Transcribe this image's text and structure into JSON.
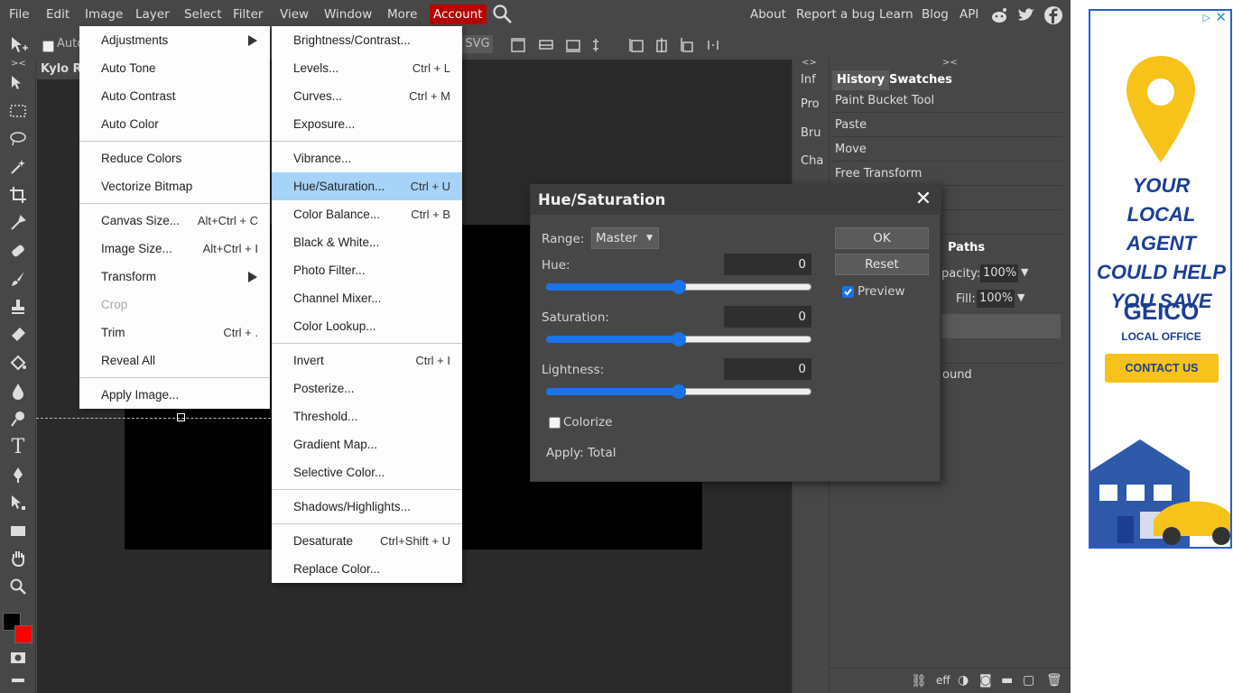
{
  "menubar": {
    "items": [
      "File",
      "Edit",
      "Image",
      "Layer",
      "Select",
      "Filter",
      "View",
      "Window",
      "More",
      "Account"
    ],
    "right_items": [
      "About",
      "Report a bug",
      "Learn",
      "Blog",
      "API"
    ]
  },
  "optbar": {
    "auto_select_label": "Auto",
    "svg_label": "SVG"
  },
  "document": {
    "tab_title": "Kylo Re"
  },
  "image_menu": {
    "items": [
      {
        "label": "Adjustments",
        "shortcut": "",
        "submenu": true
      },
      {
        "label": "Auto Tone",
        "shortcut": ""
      },
      {
        "label": "Auto Contrast",
        "shortcut": ""
      },
      {
        "label": "Auto Color",
        "shortcut": ""
      },
      {
        "sep": true
      },
      {
        "label": "Reduce Colors",
        "shortcut": ""
      },
      {
        "label": "Vectorize Bitmap",
        "shortcut": ""
      },
      {
        "sep": true
      },
      {
        "label": "Canvas Size...",
        "shortcut": "Alt+Ctrl + C"
      },
      {
        "label": "Image Size...",
        "shortcut": "Alt+Ctrl + I"
      },
      {
        "label": "Transform",
        "shortcut": "",
        "submenu": true
      },
      {
        "label": "Crop",
        "shortcut": "",
        "disabled": true
      },
      {
        "label": "Trim",
        "shortcut": "Ctrl + ."
      },
      {
        "label": "Reveal All",
        "shortcut": ""
      },
      {
        "sep": true
      },
      {
        "label": "Apply Image...",
        "shortcut": ""
      }
    ]
  },
  "adjust_menu": {
    "items": [
      {
        "label": "Brightness/Contrast...",
        "shortcut": ""
      },
      {
        "label": "Levels...",
        "shortcut": "Ctrl + L"
      },
      {
        "label": "Curves...",
        "shortcut": "Ctrl + M"
      },
      {
        "label": "Exposure...",
        "shortcut": ""
      },
      {
        "sep": true
      },
      {
        "label": "Vibrance...",
        "shortcut": ""
      },
      {
        "label": "Hue/Saturation...",
        "shortcut": "Ctrl + U",
        "highlight": true
      },
      {
        "label": "Color Balance...",
        "shortcut": "Ctrl + B"
      },
      {
        "label": "Black & White...",
        "shortcut": ""
      },
      {
        "label": "Photo Filter...",
        "shortcut": ""
      },
      {
        "label": "Channel Mixer...",
        "shortcut": ""
      },
      {
        "label": "Color Lookup...",
        "shortcut": ""
      },
      {
        "sep": true
      },
      {
        "label": "Invert",
        "shortcut": "Ctrl + I"
      },
      {
        "label": "Posterize...",
        "shortcut": ""
      },
      {
        "label": "Threshold...",
        "shortcut": ""
      },
      {
        "label": "Gradient Map...",
        "shortcut": ""
      },
      {
        "label": "Selective Color...",
        "shortcut": ""
      },
      {
        "sep": true
      },
      {
        "label": "Shadows/Highlights...",
        "shortcut": ""
      },
      {
        "sep": true
      },
      {
        "label": "Desaturate",
        "shortcut": "Ctrl+Shift + U"
      },
      {
        "label": "Replace Color...",
        "shortcut": ""
      }
    ]
  },
  "mini_panel": {
    "items": [
      "Inf",
      "Pro",
      "Bru",
      "Cha"
    ]
  },
  "history_panel": {
    "tabs": [
      "History",
      "Swatches"
    ],
    "rows": [
      "Paint Bucket Tool",
      "Paste",
      "Move",
      "Free Transform"
    ]
  },
  "layers_panel": {
    "tab_paths": "Paths",
    "opacity_label": "pacity:",
    "opacity_value": "100%",
    "fill_label": "Fill:",
    "fill_value": "100%",
    "layer_partial": "ound",
    "footer_eff": "eff"
  },
  "dialog": {
    "title": "Hue/Saturation",
    "range_label": "Range:",
    "range_value": "Master",
    "hue_label": "Hue:",
    "hue_value": "0",
    "hue_level": 0.5,
    "sat_label": "Saturation:",
    "sat_value": "0",
    "sat_level": 0.5,
    "light_label": "Lightness:",
    "light_value": "0",
    "light_level": 0.5,
    "colorize_label": "Colorize",
    "colorize_checked": false,
    "apply_label": "Apply: Total",
    "ok_label": "OK",
    "reset_label": "Reset",
    "preview_label": "Preview",
    "preview_checked": true
  },
  "ad": {
    "headline": "YOUR LOCAL AGENT COULD HELP YOU SAVE",
    "brand": "GEICO",
    "subbrand": "LOCAL OFFICE",
    "cta": "CONTACT US"
  },
  "colors": {
    "account_active": "#b60000",
    "menu_highlight": "#a6d3f7",
    "slider_blue": "#1a73e8",
    "ad_yellow": "#f5c518",
    "ad_blue": "#1b3e94"
  }
}
